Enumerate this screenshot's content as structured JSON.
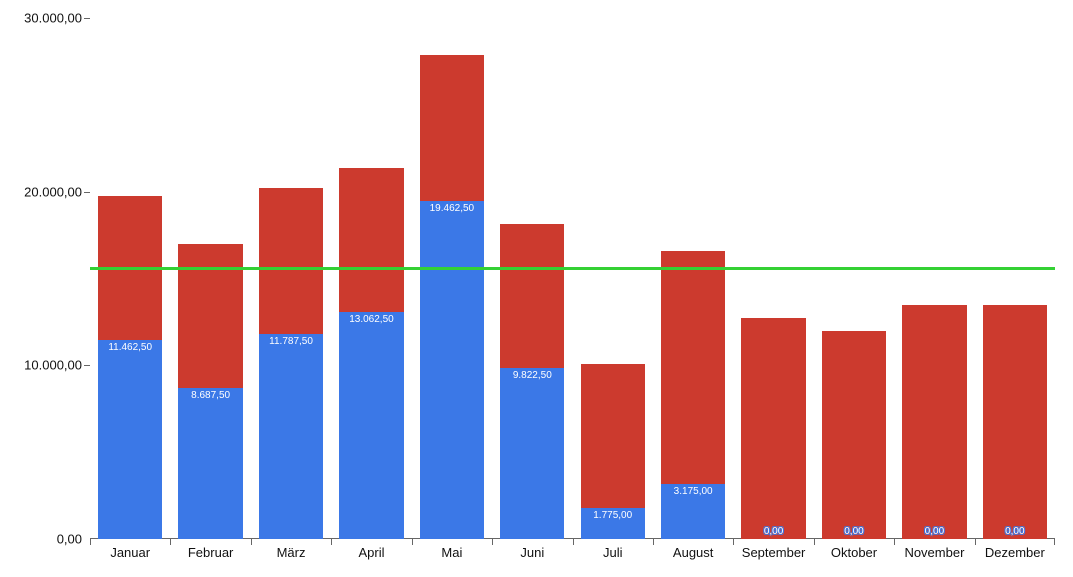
{
  "chart_data": {
    "type": "bar",
    "stacked": true,
    "categories": [
      "Januar",
      "Februar",
      "März",
      "April",
      "Mai",
      "Juni",
      "Juli",
      "August",
      "September",
      "Oktober",
      "November",
      "Dezember"
    ],
    "series": [
      {
        "name": "blue",
        "color": "#3b78e7",
        "values": [
          11462.5,
          8687.5,
          11787.5,
          13062.5,
          19462.5,
          9822.5,
          1775.0,
          3175.0,
          0.0,
          0.0,
          0.0,
          0.0
        ],
        "labels": [
          "11.462,50",
          "8.687,50",
          "11.787,50",
          "13.062,50",
          "19.462,50",
          "9.822,50",
          "1.775,00",
          "3.175,00",
          "0,00",
          "0,00",
          "0,00",
          "0,00"
        ]
      },
      {
        "name": "red",
        "color": "#cc3a2e",
        "values": [
          8300,
          8300,
          8400,
          8300,
          8400,
          8300,
          8300,
          13400,
          12700,
          12000,
          13500,
          13500
        ]
      }
    ],
    "reference_line": {
      "value": 15600,
      "color": "#34d134"
    },
    "y_ticks": [
      {
        "value": 0,
        "label": "0,00"
      },
      {
        "value": 10000,
        "label": "10.000,00"
      },
      {
        "value": 20000,
        "label": "20.000,00"
      },
      {
        "value": 30000,
        "label": "30.000,00"
      }
    ],
    "ylim": [
      0,
      30000
    ],
    "xlabel": "",
    "ylabel": "",
    "title": ""
  }
}
